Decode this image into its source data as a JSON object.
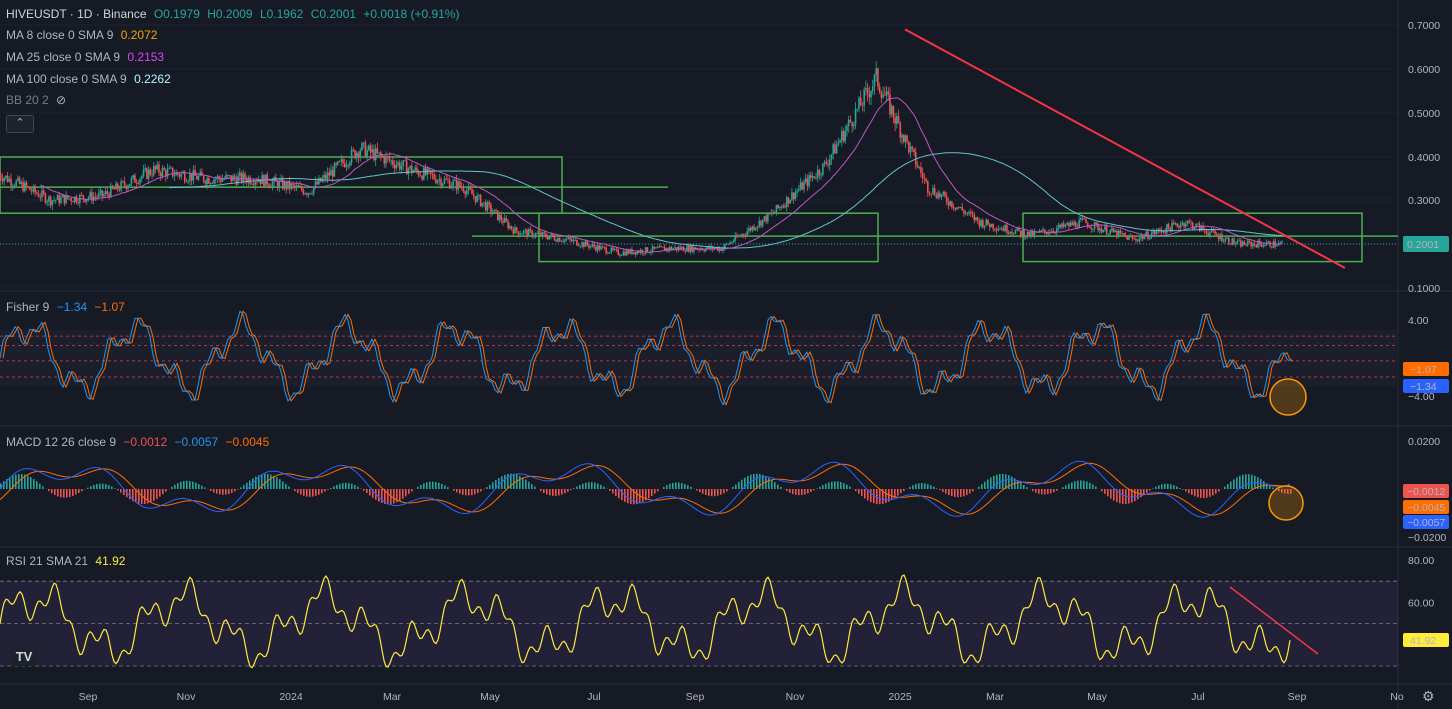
{
  "header": {
    "symbol": "HIVEUSDT · 1D · Binance",
    "open": "O0.1979",
    "high": "H0.2009",
    "low": "L0.1962",
    "close": "C0.2001",
    "change": "+0.0018 (+0.91%)"
  },
  "indicators": {
    "ma8": {
      "label": "MA 8 close 0 SMA 9",
      "value": "0.2072",
      "color": "#f7a600"
    },
    "ma25": {
      "label": "MA 25 close 0 SMA 9",
      "value": "0.2153",
      "color": "#d65bd6"
    },
    "ma100": {
      "label": "MA 100 close 0 SMA 9",
      "value": "0.2262",
      "color": "#7ee0e0"
    },
    "bb": {
      "label": "BB 20 2"
    },
    "fisher": {
      "label": "Fisher 9",
      "v1": "−1.34",
      "v2": "−1.07"
    },
    "macd": {
      "label": "MACD 12 26 close 9",
      "v1": "−0.0012",
      "v2": "−0.0057",
      "v3": "−0.0045"
    },
    "rsi": {
      "label": "RSI 21 SMA 21",
      "value": "41.92"
    }
  },
  "price_axis": [
    "0.7000",
    "0.6000",
    "0.5000",
    "0.4000",
    "0.3000",
    "0.1000"
  ],
  "price_badge": "0.2001",
  "fisher_axis": [
    "4.00",
    "−4.00"
  ],
  "fisher_badges": [
    "−1.07",
    "−1.34"
  ],
  "macd_axis": [
    "0.0200",
    "−0.0200"
  ],
  "macd_badges": [
    "−0.0012",
    "−0.0045",
    "−0.0057"
  ],
  "rsi_axis": [
    "80.00",
    "60.00"
  ],
  "rsi_badge": "41.92",
  "time_axis": [
    "Sep",
    "Nov",
    "2024",
    "Mar",
    "May",
    "Jul",
    "Sep",
    "Nov",
    "2025",
    "Mar",
    "May",
    "Jul",
    "Sep",
    "No"
  ],
  "icons": [
    "eye-off-icon",
    "chevron-up-icon",
    "tradingview-logo",
    "gear-icon"
  ],
  "colors": {
    "up": "#26a69a",
    "down": "#ef5350",
    "box": "#4caf50",
    "trend": "#f23645",
    "rsi": "#ffeb3b",
    "macd": "#2962ff",
    "signal": "#ff6d00"
  },
  "chart_data": {
    "type": "candlestick",
    "symbol": "HIVEUSDT",
    "interval": "1D",
    "ylim": [
      0.1,
      0.7
    ],
    "last_close": 0.2001,
    "close_path": [
      {
        "x": "Aug 2023",
        "y": 0.36
      },
      {
        "x": "Sep 2023",
        "y": 0.3
      },
      {
        "x": "Oct 2023",
        "y": 0.31
      },
      {
        "x": "Nov 2023",
        "y": 0.37
      },
      {
        "x": "Dec 2023",
        "y": 0.35
      },
      {
        "x": "Jan 2024",
        "y": 0.35
      },
      {
        "x": "Feb 2024",
        "y": 0.32
      },
      {
        "x": "Mar 2024",
        "y": 0.42
      },
      {
        "x": "Apr 2024",
        "y": 0.37
      },
      {
        "x": "May 2024",
        "y": 0.33
      },
      {
        "x": "Jun 2024",
        "y": 0.23
      },
      {
        "x": "Jul 2024",
        "y": 0.21
      },
      {
        "x": "Aug 2024",
        "y": 0.18
      },
      {
        "x": "Sep 2024",
        "y": 0.19
      },
      {
        "x": "Oct 2024",
        "y": 0.19
      },
      {
        "x": "Nov 2024",
        "y": 0.27
      },
      {
        "x": "Dec 2024",
        "y": 0.38
      },
      {
        "x": "Jan 2025",
        "y": 0.58
      },
      {
        "x": "Feb 2025",
        "y": 0.33
      },
      {
        "x": "Mar 2025",
        "y": 0.25
      },
      {
        "x": "Apr 2025",
        "y": 0.22
      },
      {
        "x": "May 2025",
        "y": 0.25
      },
      {
        "x": "Jun 2025",
        "y": 0.21
      },
      {
        "x": "Jul 2025",
        "y": 0.25
      },
      {
        "x": "Aug 2025",
        "y": 0.2
      }
    ],
    "zones": [
      {
        "from": "Aug 2023",
        "to": "Jun 2024",
        "low": 0.27,
        "high": 0.4
      },
      {
        "from": "Jun 2024",
        "to": "Dec 2024",
        "low": 0.16,
        "high": 0.27
      },
      {
        "from": "Mar 2025",
        "to": "Sep 2025",
        "low": 0.16,
        "high": 0.27
      }
    ],
    "trendline": {
      "from": {
        "x": "Jan 2025",
        "y": 0.69
      },
      "to": {
        "x": "Sep 2025",
        "y": 0.15
      }
    },
    "rsi": {
      "last": 41.92,
      "ylim": [
        20,
        80
      ]
    },
    "macd": {
      "macd": -0.0012,
      "signal": -0.0057,
      "hist": -0.0045
    }
  }
}
